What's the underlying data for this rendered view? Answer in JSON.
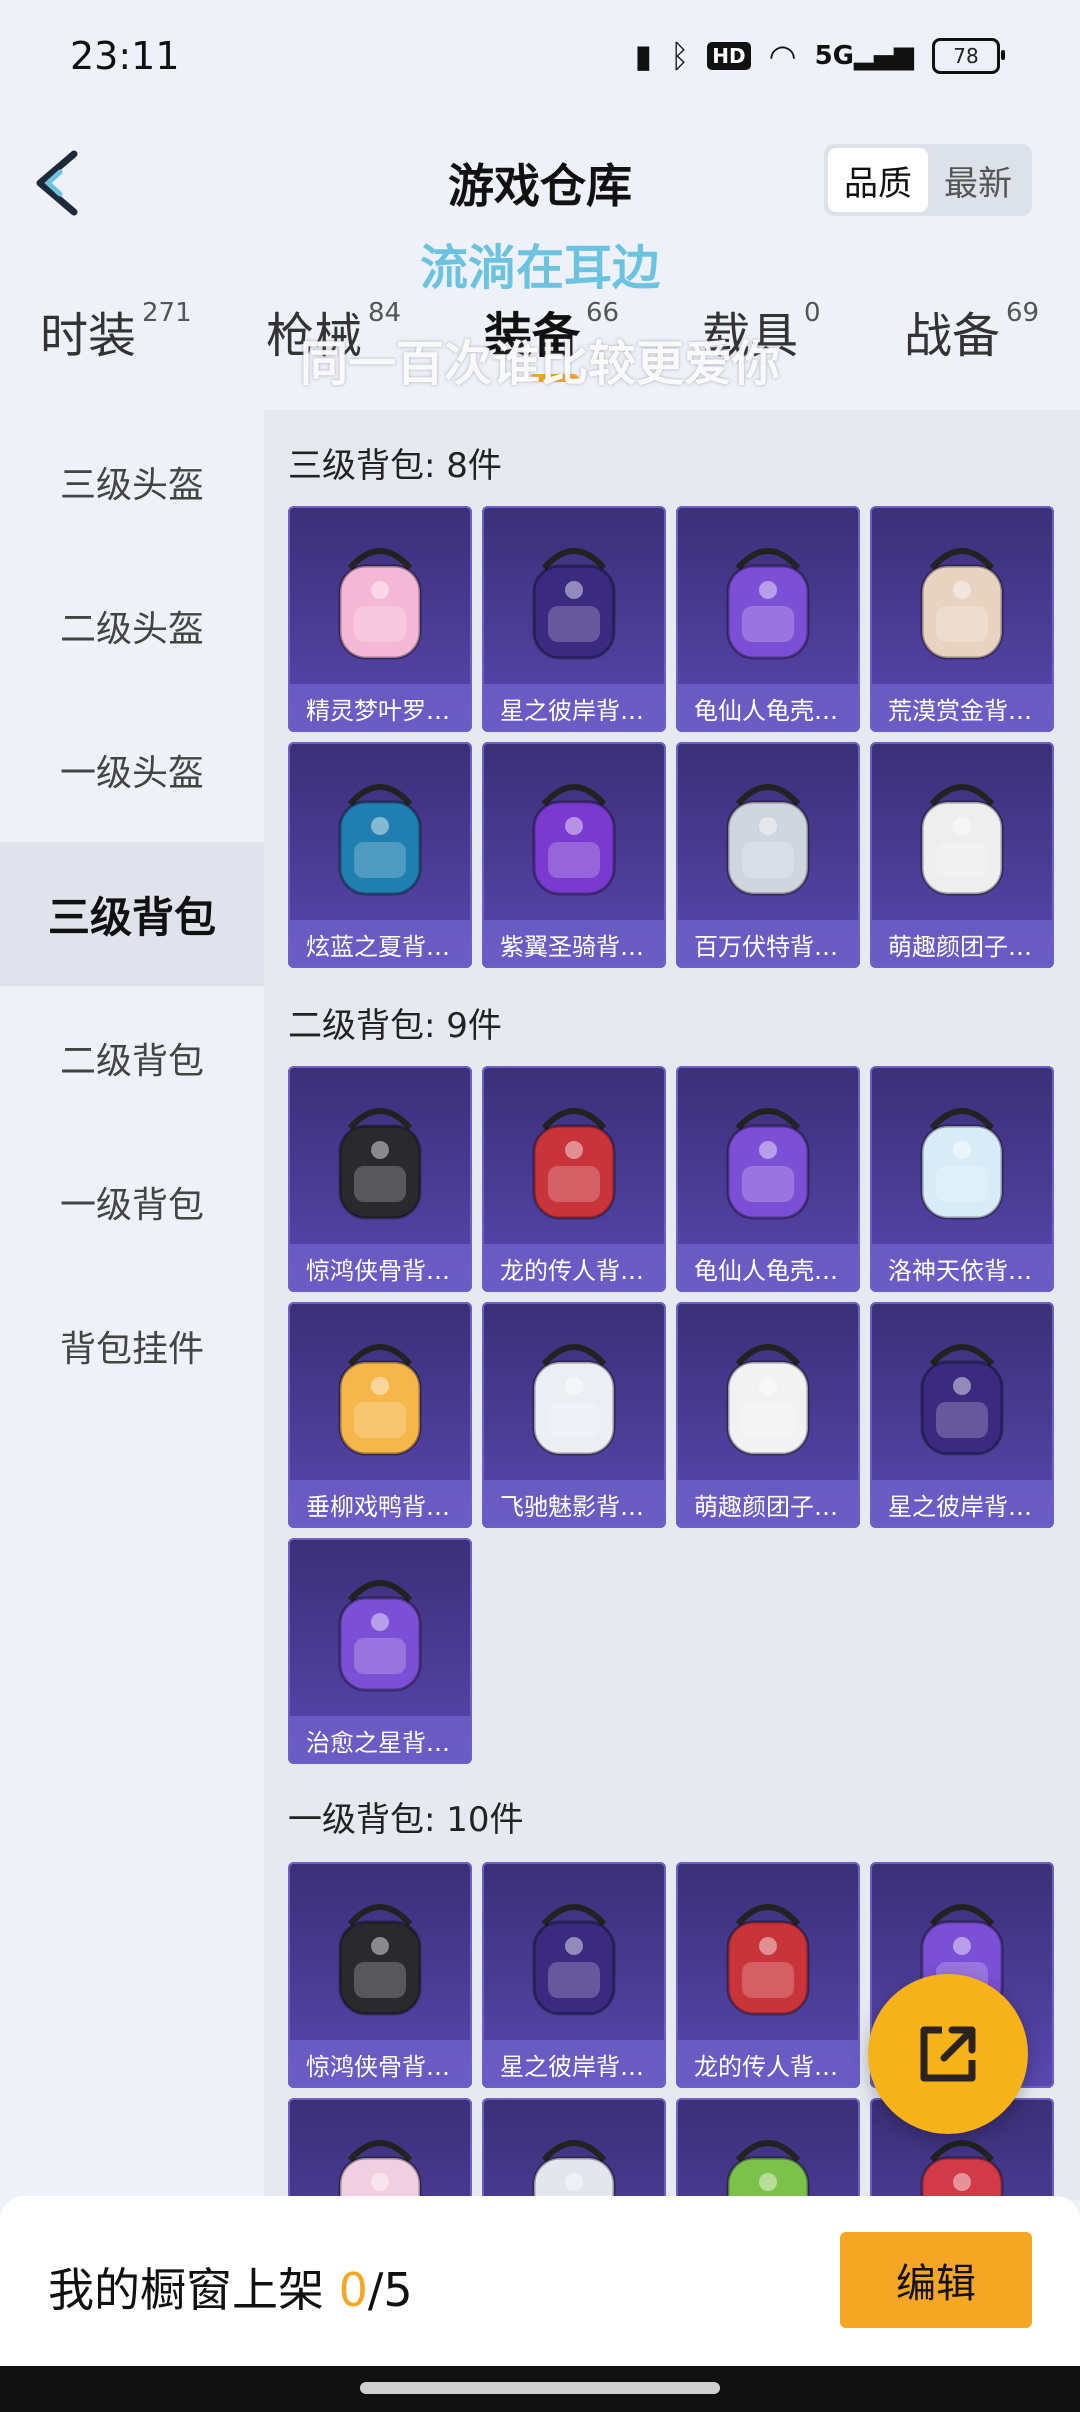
{
  "status_bar": {
    "time": "23:11",
    "network": "5G",
    "battery": "78"
  },
  "header": {
    "title": "游戏仓库",
    "sort_options": [
      {
        "label": "品质",
        "active": true
      },
      {
        "label": "最新",
        "active": false
      }
    ]
  },
  "lyrics": {
    "line1": "流淌在耳边",
    "line2": "同一百次谁比较更爱你"
  },
  "categories": [
    {
      "label": "时装",
      "count": "271"
    },
    {
      "label": "枪械",
      "count": "84"
    },
    {
      "label": "装备",
      "count": "66",
      "active": true
    },
    {
      "label": "载具",
      "count": "0"
    },
    {
      "label": "战备",
      "count": "69"
    }
  ],
  "sidebar": {
    "items": [
      "三级头盔",
      "二级头盔",
      "一级头盔",
      "三级背包",
      "二级背包",
      "一级背包",
      "背包挂件"
    ],
    "active": "三级背包"
  },
  "sections": [
    {
      "title": "三级背包: 8件",
      "items": [
        "精灵梦叶罗…",
        "星之彼岸背…",
        "龟仙人龟壳…",
        "荒漠赏金背…",
        "炫蓝之夏背…",
        "紫翼圣骑背…",
        "百万伏特背…",
        "萌趣颜团子…"
      ]
    },
    {
      "title": "二级背包: 9件",
      "items": [
        "惊鸿侠骨背…",
        "龙的传人背…",
        "龟仙人龟壳…",
        "洛神天依背…",
        "垂柳戏鸭背…",
        "飞驰魅影背…",
        "萌趣颜团子…",
        "星之彼岸背…",
        "治愈之星背…"
      ]
    },
    {
      "title": "一级背包: 10件",
      "items": [
        "惊鸿侠骨背…",
        "星之彼岸背…",
        "龙的传人背…",
        "",
        "",
        "",
        "",
        ""
      ]
    }
  ],
  "item_colors": [
    [
      "#f4b8d6",
      "#3a2a80",
      "#7b4fd6",
      "#e8d2c0",
      "#1f7fb0",
      "#7a3ad0",
      "#d0d6e0",
      "#eeeeee"
    ],
    [
      "#2a2a2e",
      "#c8343a",
      "#7b4fd6",
      "#d8ecf8",
      "#f5b64a",
      "#eceef4",
      "#f2f2f2",
      "#3a2a80"
    ],
    [
      "#2a2a2e",
      "#3a2a80",
      "#c8343a",
      "#7b4fd6",
      "#f0d0e0",
      "#e4e6ee",
      "#7cc24a",
      "#d23a4a"
    ]
  ],
  "bottom_bar": {
    "label": "我的橱窗上架 ",
    "count": "0",
    "total": "/5",
    "edit_label": "编辑"
  }
}
